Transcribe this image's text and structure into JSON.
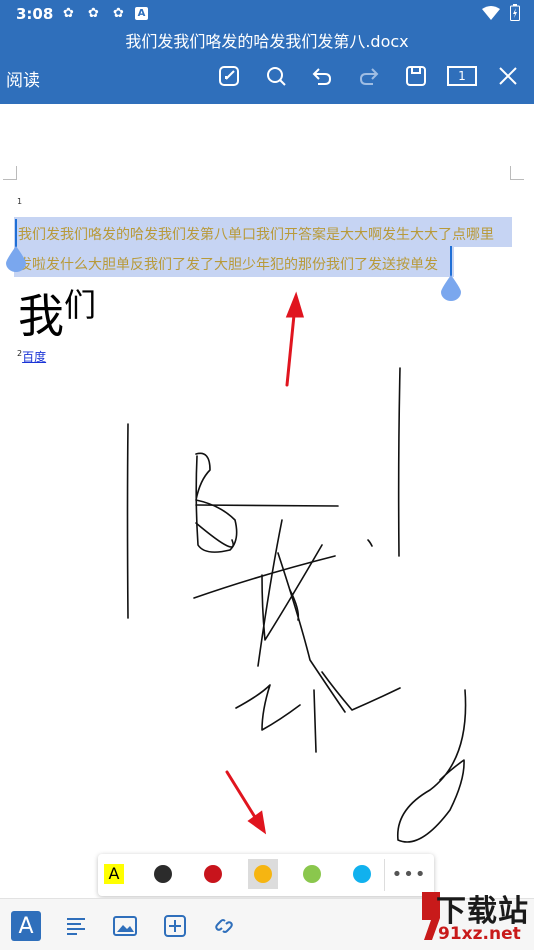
{
  "status_bar": {
    "time": "3:08",
    "app_badge": "A"
  },
  "header": {
    "document_title": "我们发我们咯发的哈发我们发第八.docx",
    "read_label": "阅读",
    "page_indicator": "1",
    "background_color": "#2f6fbb"
  },
  "document": {
    "footnote_number": "1",
    "paragraph_line_1": "我们发我们咯发的哈发我们发第八单口我们开答案是大大啊发生大大了点哪里",
    "paragraph_line_2": "发啦发什么大胆单反我们了发了大胆少年犯的那份我们了发送按单发",
    "big_word_main": "我",
    "big_word_small": "们",
    "footnote_ref_number": "2",
    "footnote_link": "百度",
    "selection_color": "#c6d4f3",
    "text_color": "#b89a3a"
  },
  "palette": {
    "highlight_label": "A",
    "colors": [
      {
        "name": "black",
        "hex": "#2b2b2b"
      },
      {
        "name": "red",
        "hex": "#c8141c"
      },
      {
        "name": "orange",
        "hex": "#f6b511"
      },
      {
        "name": "green",
        "hex": "#8ac74d"
      },
      {
        "name": "blue",
        "hex": "#11b1ee"
      }
    ],
    "selected": "orange",
    "more_label": "•••"
  },
  "bottom_bar": {
    "pen_label": "A",
    "items": [
      "pen-tool",
      "paragraph",
      "image",
      "insert",
      "link"
    ]
  },
  "watermark": {
    "main_text": "下载站",
    "sub_text": "91xz.net"
  },
  "annotation_color": "#e0151f"
}
